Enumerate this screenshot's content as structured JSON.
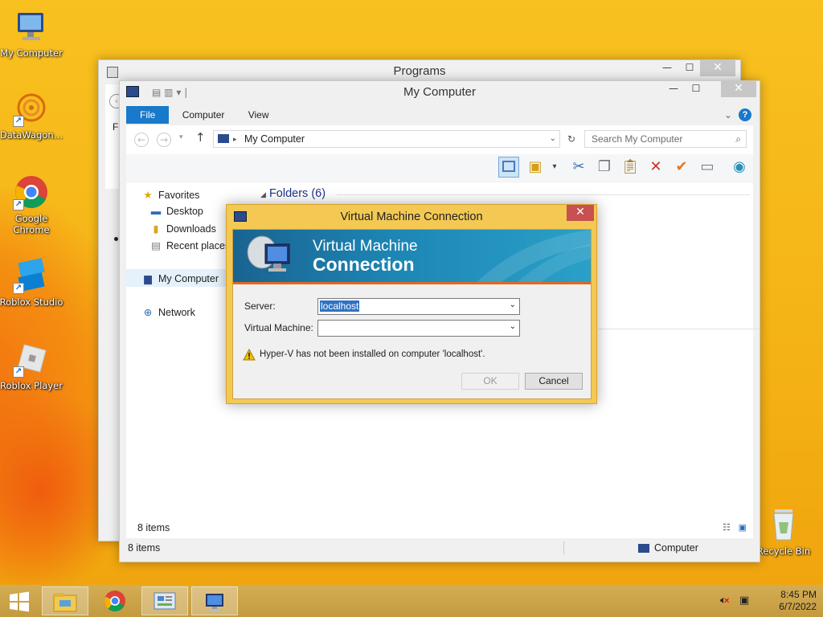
{
  "desktop": {
    "icons": [
      {
        "label": "My Computer",
        "icon": "monitor-icon"
      },
      {
        "label": "DataWagon…",
        "icon": "datawagon-icon"
      },
      {
        "label": "Google Chrome",
        "icon": "chrome-icon"
      },
      {
        "label": "Roblox Studio",
        "icon": "roblox-studio-icon"
      },
      {
        "label": "Roblox Player",
        "icon": "roblox-player-icon"
      },
      {
        "label": "Recycle Bin",
        "icon": "recycle-bin-icon"
      }
    ]
  },
  "programs_window": {
    "title": "Programs",
    "sidebar_fragment": "Fi"
  },
  "explorer": {
    "title": "My Computer",
    "tabs": [
      "File",
      "Computer",
      "View"
    ],
    "address": "My Computer",
    "search_placeholder": "Search My Computer",
    "nav": {
      "favorites": "Favorites",
      "desktop": "Desktop",
      "downloads": "Downloads",
      "recent": "Recent places",
      "computer": "My Computer",
      "network": "Network"
    },
    "section_header": "Folders (6)",
    "status_inner": "8 items",
    "status_outer": "8 items",
    "status_computer": "Computer"
  },
  "vm_dialog": {
    "title": "Virtual Machine Connection",
    "banner_line1": "Virtual Machine",
    "banner_line2": "Connection",
    "server_label": "Server:",
    "server_value": "localhost",
    "vm_label": "Virtual Machine:",
    "vm_value": "",
    "warning": "Hyper-V has not been installed on computer 'localhost'.",
    "ok_label": "OK",
    "cancel_label": "Cancel"
  },
  "taskbar": {
    "time": "8:45 PM",
    "date": "6/7/2022"
  },
  "colors": {
    "desktop_bg": "#f5b416",
    "ribbon_file_tab": "#1979ca",
    "dialog_frame": "#f3c954",
    "banner": "#1d86b4",
    "close_red": "#c75050"
  }
}
